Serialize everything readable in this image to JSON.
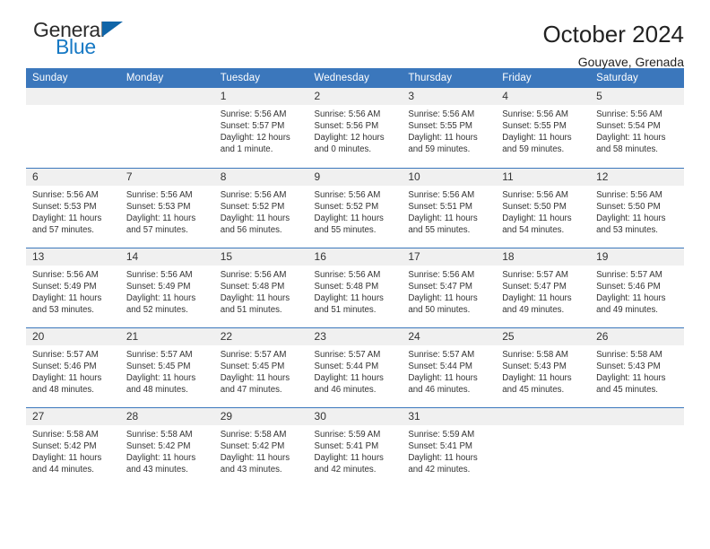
{
  "logo": {
    "word_one": "General",
    "word_two": "Blue",
    "triangle_icon": "triangle-icon",
    "accent_dark": "#1065a8",
    "accent_blue": "#1779c4"
  },
  "header": {
    "title": "October 2024",
    "subtitle": "Gouyave, Grenada"
  },
  "theme": {
    "header_blue": "#3b77bc",
    "daynum_bg": "#f0f0f0",
    "text": "#333333"
  },
  "calendar": {
    "weekday_headers": [
      "Sunday",
      "Monday",
      "Tuesday",
      "Wednesday",
      "Thursday",
      "Friday",
      "Saturday"
    ],
    "weeks": [
      [
        {
          "day": "",
          "sunrise": "",
          "sunset": "",
          "daylight_line1": "",
          "daylight_line2": "",
          "empty": true
        },
        {
          "day": "",
          "sunrise": "",
          "sunset": "",
          "daylight_line1": "",
          "daylight_line2": "",
          "empty": true
        },
        {
          "day": "1",
          "sunrise": "Sunrise: 5:56 AM",
          "sunset": "Sunset: 5:57 PM",
          "daylight_line1": "Daylight: 12 hours",
          "daylight_line2": "and 1 minute.",
          "empty": false
        },
        {
          "day": "2",
          "sunrise": "Sunrise: 5:56 AM",
          "sunset": "Sunset: 5:56 PM",
          "daylight_line1": "Daylight: 12 hours",
          "daylight_line2": "and 0 minutes.",
          "empty": false
        },
        {
          "day": "3",
          "sunrise": "Sunrise: 5:56 AM",
          "sunset": "Sunset: 5:55 PM",
          "daylight_line1": "Daylight: 11 hours",
          "daylight_line2": "and 59 minutes.",
          "empty": false
        },
        {
          "day": "4",
          "sunrise": "Sunrise: 5:56 AM",
          "sunset": "Sunset: 5:55 PM",
          "daylight_line1": "Daylight: 11 hours",
          "daylight_line2": "and 59 minutes.",
          "empty": false
        },
        {
          "day": "5",
          "sunrise": "Sunrise: 5:56 AM",
          "sunset": "Sunset: 5:54 PM",
          "daylight_line1": "Daylight: 11 hours",
          "daylight_line2": "and 58 minutes.",
          "empty": false
        }
      ],
      [
        {
          "day": "6",
          "sunrise": "Sunrise: 5:56 AM",
          "sunset": "Sunset: 5:53 PM",
          "daylight_line1": "Daylight: 11 hours",
          "daylight_line2": "and 57 minutes.",
          "empty": false
        },
        {
          "day": "7",
          "sunrise": "Sunrise: 5:56 AM",
          "sunset": "Sunset: 5:53 PM",
          "daylight_line1": "Daylight: 11 hours",
          "daylight_line2": "and 57 minutes.",
          "empty": false
        },
        {
          "day": "8",
          "sunrise": "Sunrise: 5:56 AM",
          "sunset": "Sunset: 5:52 PM",
          "daylight_line1": "Daylight: 11 hours",
          "daylight_line2": "and 56 minutes.",
          "empty": false
        },
        {
          "day": "9",
          "sunrise": "Sunrise: 5:56 AM",
          "sunset": "Sunset: 5:52 PM",
          "daylight_line1": "Daylight: 11 hours",
          "daylight_line2": "and 55 minutes.",
          "empty": false
        },
        {
          "day": "10",
          "sunrise": "Sunrise: 5:56 AM",
          "sunset": "Sunset: 5:51 PM",
          "daylight_line1": "Daylight: 11 hours",
          "daylight_line2": "and 55 minutes.",
          "empty": false
        },
        {
          "day": "11",
          "sunrise": "Sunrise: 5:56 AM",
          "sunset": "Sunset: 5:50 PM",
          "daylight_line1": "Daylight: 11 hours",
          "daylight_line2": "and 54 minutes.",
          "empty": false
        },
        {
          "day": "12",
          "sunrise": "Sunrise: 5:56 AM",
          "sunset": "Sunset: 5:50 PM",
          "daylight_line1": "Daylight: 11 hours",
          "daylight_line2": "and 53 minutes.",
          "empty": false
        }
      ],
      [
        {
          "day": "13",
          "sunrise": "Sunrise: 5:56 AM",
          "sunset": "Sunset: 5:49 PM",
          "daylight_line1": "Daylight: 11 hours",
          "daylight_line2": "and 53 minutes.",
          "empty": false
        },
        {
          "day": "14",
          "sunrise": "Sunrise: 5:56 AM",
          "sunset": "Sunset: 5:49 PM",
          "daylight_line1": "Daylight: 11 hours",
          "daylight_line2": "and 52 minutes.",
          "empty": false
        },
        {
          "day": "15",
          "sunrise": "Sunrise: 5:56 AM",
          "sunset": "Sunset: 5:48 PM",
          "daylight_line1": "Daylight: 11 hours",
          "daylight_line2": "and 51 minutes.",
          "empty": false
        },
        {
          "day": "16",
          "sunrise": "Sunrise: 5:56 AM",
          "sunset": "Sunset: 5:48 PM",
          "daylight_line1": "Daylight: 11 hours",
          "daylight_line2": "and 51 minutes.",
          "empty": false
        },
        {
          "day": "17",
          "sunrise": "Sunrise: 5:56 AM",
          "sunset": "Sunset: 5:47 PM",
          "daylight_line1": "Daylight: 11 hours",
          "daylight_line2": "and 50 minutes.",
          "empty": false
        },
        {
          "day": "18",
          "sunrise": "Sunrise: 5:57 AM",
          "sunset": "Sunset: 5:47 PM",
          "daylight_line1": "Daylight: 11 hours",
          "daylight_line2": "and 49 minutes.",
          "empty": false
        },
        {
          "day": "19",
          "sunrise": "Sunrise: 5:57 AM",
          "sunset": "Sunset: 5:46 PM",
          "daylight_line1": "Daylight: 11 hours",
          "daylight_line2": "and 49 minutes.",
          "empty": false
        }
      ],
      [
        {
          "day": "20",
          "sunrise": "Sunrise: 5:57 AM",
          "sunset": "Sunset: 5:46 PM",
          "daylight_line1": "Daylight: 11 hours",
          "daylight_line2": "and 48 minutes.",
          "empty": false
        },
        {
          "day": "21",
          "sunrise": "Sunrise: 5:57 AM",
          "sunset": "Sunset: 5:45 PM",
          "daylight_line1": "Daylight: 11 hours",
          "daylight_line2": "and 48 minutes.",
          "empty": false
        },
        {
          "day": "22",
          "sunrise": "Sunrise: 5:57 AM",
          "sunset": "Sunset: 5:45 PM",
          "daylight_line1": "Daylight: 11 hours",
          "daylight_line2": "and 47 minutes.",
          "empty": false
        },
        {
          "day": "23",
          "sunrise": "Sunrise: 5:57 AM",
          "sunset": "Sunset: 5:44 PM",
          "daylight_line1": "Daylight: 11 hours",
          "daylight_line2": "and 46 minutes.",
          "empty": false
        },
        {
          "day": "24",
          "sunrise": "Sunrise: 5:57 AM",
          "sunset": "Sunset: 5:44 PM",
          "daylight_line1": "Daylight: 11 hours",
          "daylight_line2": "and 46 minutes.",
          "empty": false
        },
        {
          "day": "25",
          "sunrise": "Sunrise: 5:58 AM",
          "sunset": "Sunset: 5:43 PM",
          "daylight_line1": "Daylight: 11 hours",
          "daylight_line2": "and 45 minutes.",
          "empty": false
        },
        {
          "day": "26",
          "sunrise": "Sunrise: 5:58 AM",
          "sunset": "Sunset: 5:43 PM",
          "daylight_line1": "Daylight: 11 hours",
          "daylight_line2": "and 45 minutes.",
          "empty": false
        }
      ],
      [
        {
          "day": "27",
          "sunrise": "Sunrise: 5:58 AM",
          "sunset": "Sunset: 5:42 PM",
          "daylight_line1": "Daylight: 11 hours",
          "daylight_line2": "and 44 minutes.",
          "empty": false
        },
        {
          "day": "28",
          "sunrise": "Sunrise: 5:58 AM",
          "sunset": "Sunset: 5:42 PM",
          "daylight_line1": "Daylight: 11 hours",
          "daylight_line2": "and 43 minutes.",
          "empty": false
        },
        {
          "day": "29",
          "sunrise": "Sunrise: 5:58 AM",
          "sunset": "Sunset: 5:42 PM",
          "daylight_line1": "Daylight: 11 hours",
          "daylight_line2": "and 43 minutes.",
          "empty": false
        },
        {
          "day": "30",
          "sunrise": "Sunrise: 5:59 AM",
          "sunset": "Sunset: 5:41 PM",
          "daylight_line1": "Daylight: 11 hours",
          "daylight_line2": "and 42 minutes.",
          "empty": false
        },
        {
          "day": "31",
          "sunrise": "Sunrise: 5:59 AM",
          "sunset": "Sunset: 5:41 PM",
          "daylight_line1": "Daylight: 11 hours",
          "daylight_line2": "and 42 minutes.",
          "empty": false
        },
        {
          "day": "",
          "sunrise": "",
          "sunset": "",
          "daylight_line1": "",
          "daylight_line2": "",
          "empty": true
        },
        {
          "day": "",
          "sunrise": "",
          "sunset": "",
          "daylight_line1": "",
          "daylight_line2": "",
          "empty": true
        }
      ]
    ]
  }
}
